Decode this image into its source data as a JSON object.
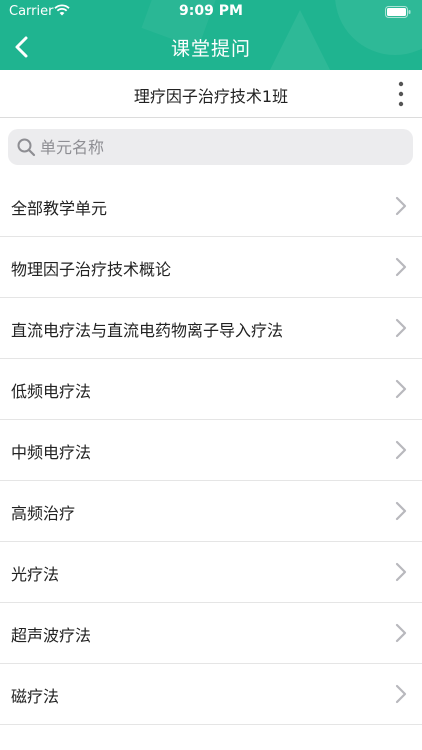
{
  "status_bar": {
    "carrier": "Carrier",
    "time": "9:09 PM"
  },
  "header": {
    "title": "课堂提问",
    "background_color": "#1fb490",
    "back_icon": "chevron-left-icon"
  },
  "class_bar": {
    "title": "理疗因子治疗技术1班",
    "more_icon": "more-vertical-icon"
  },
  "search": {
    "placeholder": "单元名称",
    "value": ""
  },
  "units": [
    {
      "label": "全部教学单元"
    },
    {
      "label": "物理因子治疗技术概论"
    },
    {
      "label": "直流电疗法与直流电药物离子导入疗法"
    },
    {
      "label": "低频电疗法"
    },
    {
      "label": "中频电疗法"
    },
    {
      "label": "高频治疗"
    },
    {
      "label": "光疗法"
    },
    {
      "label": "超声波疗法"
    },
    {
      "label": "磁疗法"
    }
  ]
}
